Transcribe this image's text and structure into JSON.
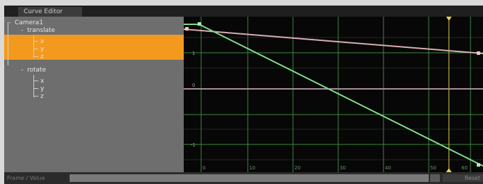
{
  "window": {
    "tab_label": "Curve Editor"
  },
  "tree": {
    "root": {
      "label": "Camera1",
      "expander": "-"
    },
    "groups": [
      {
        "label": "translate",
        "expander": "-",
        "channels": [
          "x",
          "y",
          "z"
        ],
        "selected": true
      },
      {
        "label": "rotate",
        "expander": "-",
        "channels": [
          "x",
          "y",
          "z"
        ],
        "selected": false
      }
    ]
  },
  "graph": {
    "y_ticks": [
      "1",
      "0",
      "-1"
    ],
    "x_ticks": [
      "0",
      "10",
      "20",
      "30",
      "40",
      "50",
      "60"
    ],
    "current_frame_marker_icon": "triangle-marker-icon"
  },
  "status": {
    "label": "Frame / Value",
    "field_value": "",
    "reset_label": "Reset"
  },
  "colors": {
    "selection": "#f39a1e",
    "grid_major": "#3c8a3c",
    "curve_green": "#7fdd8a",
    "curve_pink": "#d9aeb2",
    "marker": "#e8d24a"
  }
}
